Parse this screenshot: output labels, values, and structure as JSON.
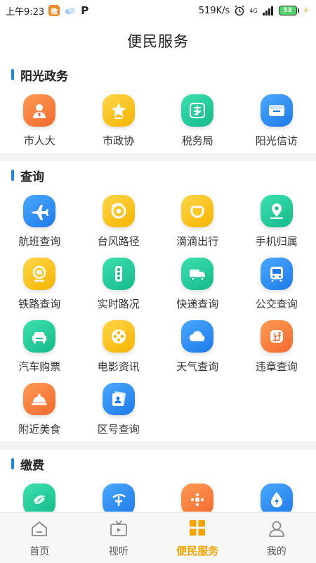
{
  "status_bar": {
    "time": "上午9:23",
    "weibo_glyph": "微",
    "p_glyph": "P",
    "network_speed": "519K/s",
    "network_type": "4G",
    "battery": "53",
    "icons": [
      "weibo-app-icon",
      "cloud-icon",
      "p-app-icon",
      "alarm-icon",
      "signal-icon",
      "battery-icon",
      "charging-icon"
    ]
  },
  "header": {
    "title": "便民服务"
  },
  "sections": {
    "government": {
      "title": "阳光政务",
      "items": [
        {
          "label": "市人大",
          "color": "#f26a2e",
          "icon": "person-icon"
        },
        {
          "label": "市政协",
          "color": "#f5b400",
          "icon": "star-icon"
        },
        {
          "label": "税务局",
          "color": "#14b98a",
          "icon": "tax-icon"
        },
        {
          "label": "阳光信访",
          "color": "#1e7ae8",
          "icon": "mailbox-icon"
        }
      ]
    },
    "query": {
      "title": "查询",
      "items": [
        {
          "label": "航班查询",
          "color": "#1e7ae8",
          "icon": "airplane-icon"
        },
        {
          "label": "台风路径",
          "color": "#f5b400",
          "icon": "typhoon-icon"
        },
        {
          "label": "滴滴出行",
          "color": "#f5b400",
          "icon": "didi-icon"
        },
        {
          "label": "手机归属",
          "color": "#14b98a",
          "icon": "location-icon"
        },
        {
          "label": "铁路查询",
          "color": "#f5b400",
          "icon": "train-icon"
        },
        {
          "label": "实时路况",
          "color": "#14b98a",
          "icon": "traffic-light-icon"
        },
        {
          "label": "快递查询",
          "color": "#14b98a",
          "icon": "truck-icon"
        },
        {
          "label": "公交查询",
          "color": "#1e7ae8",
          "icon": "bus-icon"
        },
        {
          "label": "汽车购票",
          "color": "#14b98a",
          "icon": "car-icon"
        },
        {
          "label": "电影资讯",
          "color": "#f5b400",
          "icon": "film-reel-icon"
        },
        {
          "label": "天气查询",
          "color": "#1e7ae8",
          "icon": "cloud-icon"
        },
        {
          "label": "违章查询",
          "color": "#f26a2e",
          "icon": "violation-icon"
        },
        {
          "label": "附近美食",
          "color": "#f26a2e",
          "icon": "food-cloche-icon"
        },
        {
          "label": "区号查询",
          "color": "#1e7ae8",
          "icon": "contact-card-icon"
        }
      ]
    },
    "payment": {
      "title": "缴费",
      "items": [
        {
          "label": "",
          "color": "#14b98a",
          "icon": "china-mobile-icon"
        },
        {
          "label": "",
          "color": "#1e7ae8",
          "icon": "china-telecom-icon"
        },
        {
          "label": "",
          "color": "#f26a2e",
          "icon": "china-unicom-icon"
        },
        {
          "label": "",
          "color": "#1e7ae8",
          "icon": "water-electric-icon"
        }
      ]
    }
  },
  "tab_bar": {
    "tabs": [
      {
        "label": "首页",
        "icon": "home-icon",
        "active": false
      },
      {
        "label": "视听",
        "icon": "tv-icon",
        "active": false
      },
      {
        "label": "便民服务",
        "icon": "grid-icon",
        "active": true
      },
      {
        "label": "我的",
        "icon": "user-icon",
        "active": false
      }
    ]
  },
  "colors": {
    "accent": "#1e88e5",
    "active_tab": "#f5a300",
    "orange": "#f26a2e",
    "yellow": "#f5b400",
    "green": "#14b98a",
    "blue": "#1e7ae8"
  }
}
